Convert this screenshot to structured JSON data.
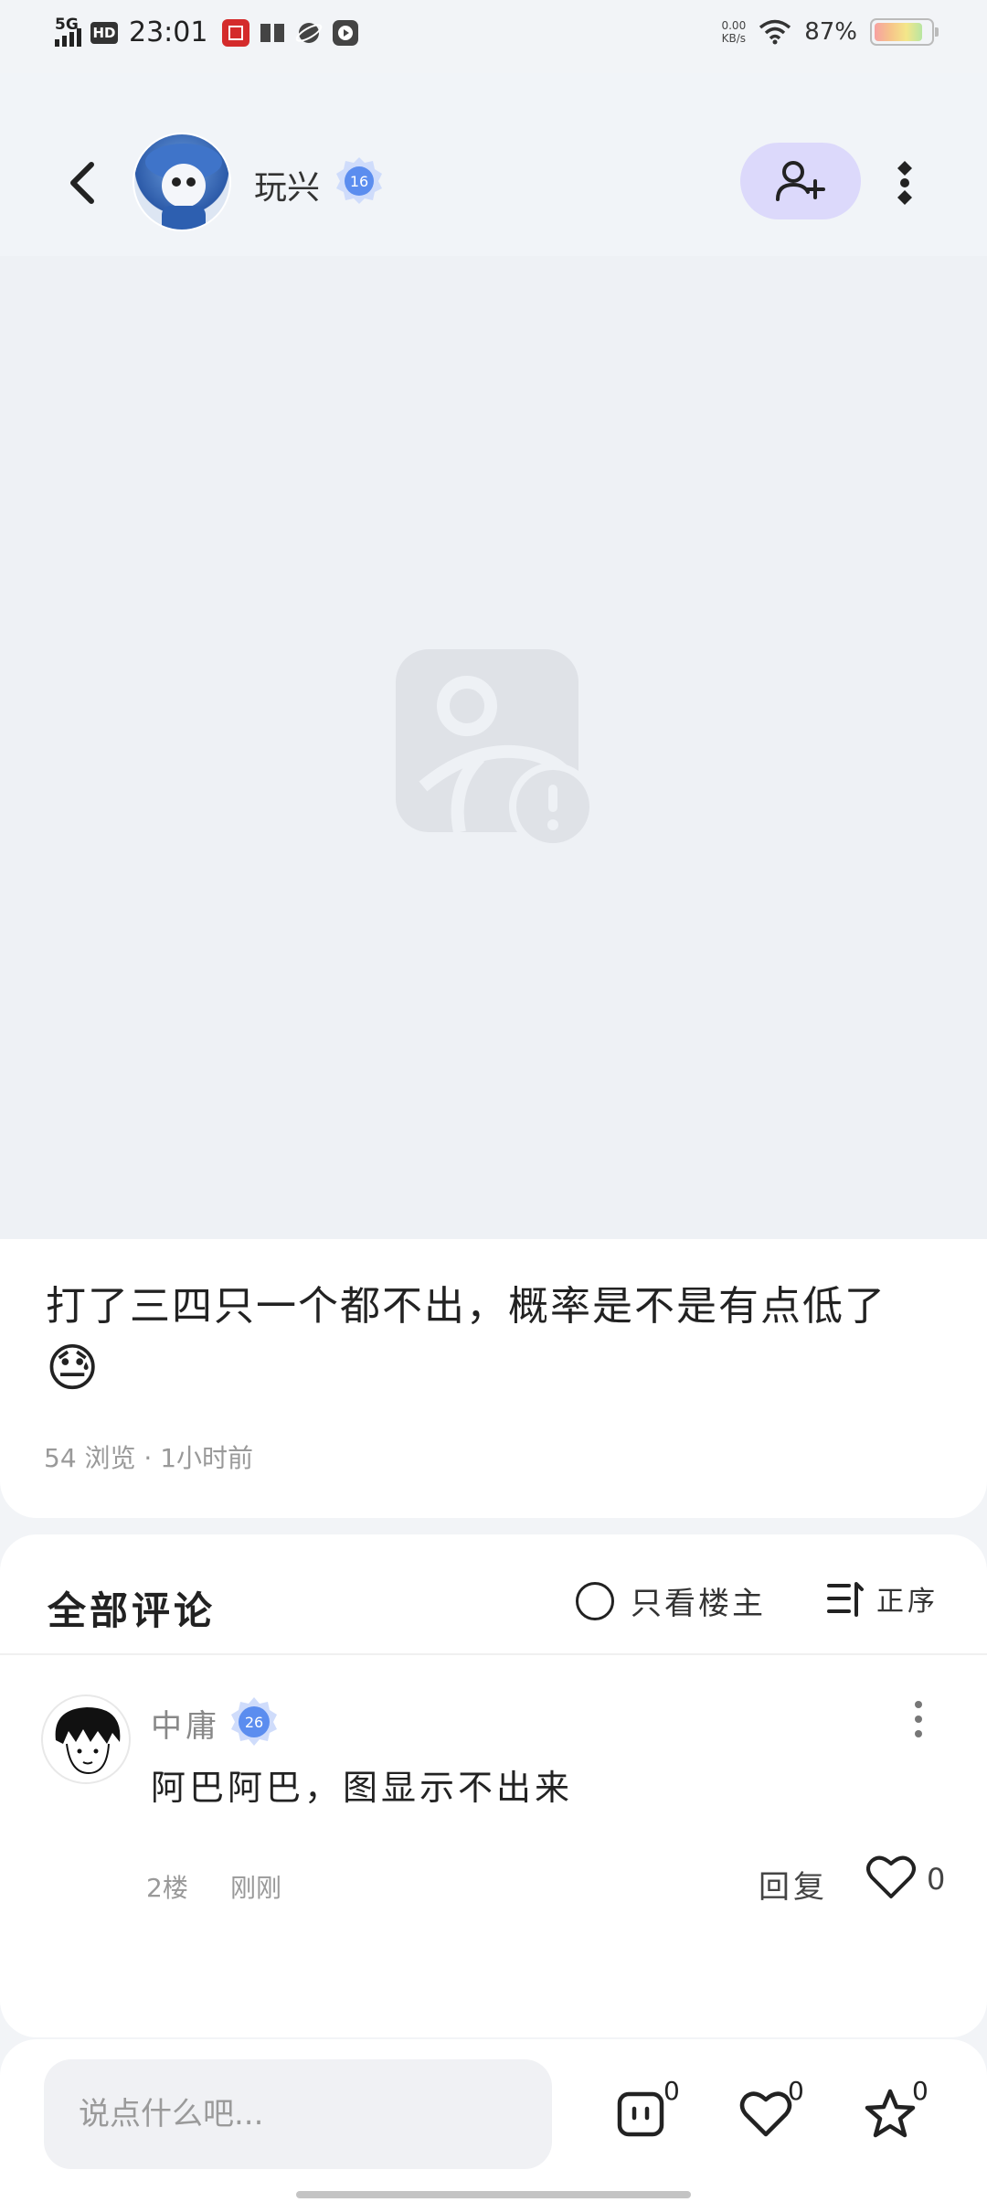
{
  "status": {
    "network": "5G",
    "hd": "HD",
    "time": "23:01",
    "speed_top": "0.00",
    "speed_unit": "KB/s",
    "battery": "87%"
  },
  "header": {
    "username": "玩兴",
    "level": "16",
    "follow_icon": "add-user-icon",
    "more_icon": "more-vertical-icon",
    "back_icon": "back-arrow-icon"
  },
  "post": {
    "image_status_icon": "image-load-failed-icon",
    "text": "打了三四只一个都不出，概率是不是有点低了",
    "emoji": "😓",
    "meta": "54 浏览 · 1小时前"
  },
  "comments": {
    "title": "全部评论",
    "only_owner": "只看楼主",
    "sort": "正序",
    "items": [
      {
        "name": "中庸",
        "level": "26",
        "text": "阿巴阿巴，图显示不出来",
        "floor": "2楼",
        "time": "刚刚",
        "reply": "回复",
        "likes": "0"
      }
    ]
  },
  "bottom": {
    "placeholder": "说点什么吧...",
    "comment_count": "0",
    "like_count": "0",
    "fav_count": "0"
  },
  "colors": {
    "follow_bg": "#dcd9fb",
    "badge_blue": "#5b8def",
    "page_bg": "#f2f4f7"
  }
}
